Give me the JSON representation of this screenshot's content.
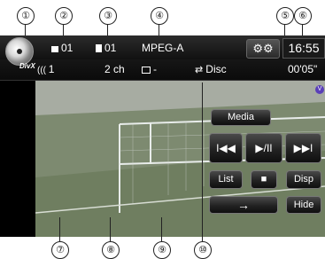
{
  "callouts": [
    "①",
    "②",
    "③",
    "④",
    "⑤",
    "⑥",
    "⑦",
    "⑧",
    "⑨",
    "⑩"
  ],
  "header": {
    "disc_brand": "DivX",
    "folder_number": "01",
    "track_number": "01",
    "audio_format": "MPEG-A",
    "clock": "16:55"
  },
  "subbar": {
    "audio_stream": "1",
    "channels": "2 ch",
    "subtitle": "-",
    "repeat_mode": "Disc",
    "elapsed_time": "00'05\""
  },
  "controls": {
    "media_label": "Media",
    "prev_label": "I◀◀",
    "play_pause_label": "▶/II",
    "next_label": "▶▶I",
    "list_label": "List",
    "stop_label": "■",
    "disp_label": "Disp",
    "arrow_label": "→",
    "hide_label": "Hide"
  },
  "badge": "V",
  "icons": [
    "disc-icon",
    "folder-icon",
    "file-icon",
    "gear-icon",
    "speaker-icon",
    "subtitle-icon",
    "repeat-icon"
  ],
  "colors": {
    "screen_bg": "#000000",
    "badge": "#5a3fb8",
    "text": "#ffffff"
  }
}
